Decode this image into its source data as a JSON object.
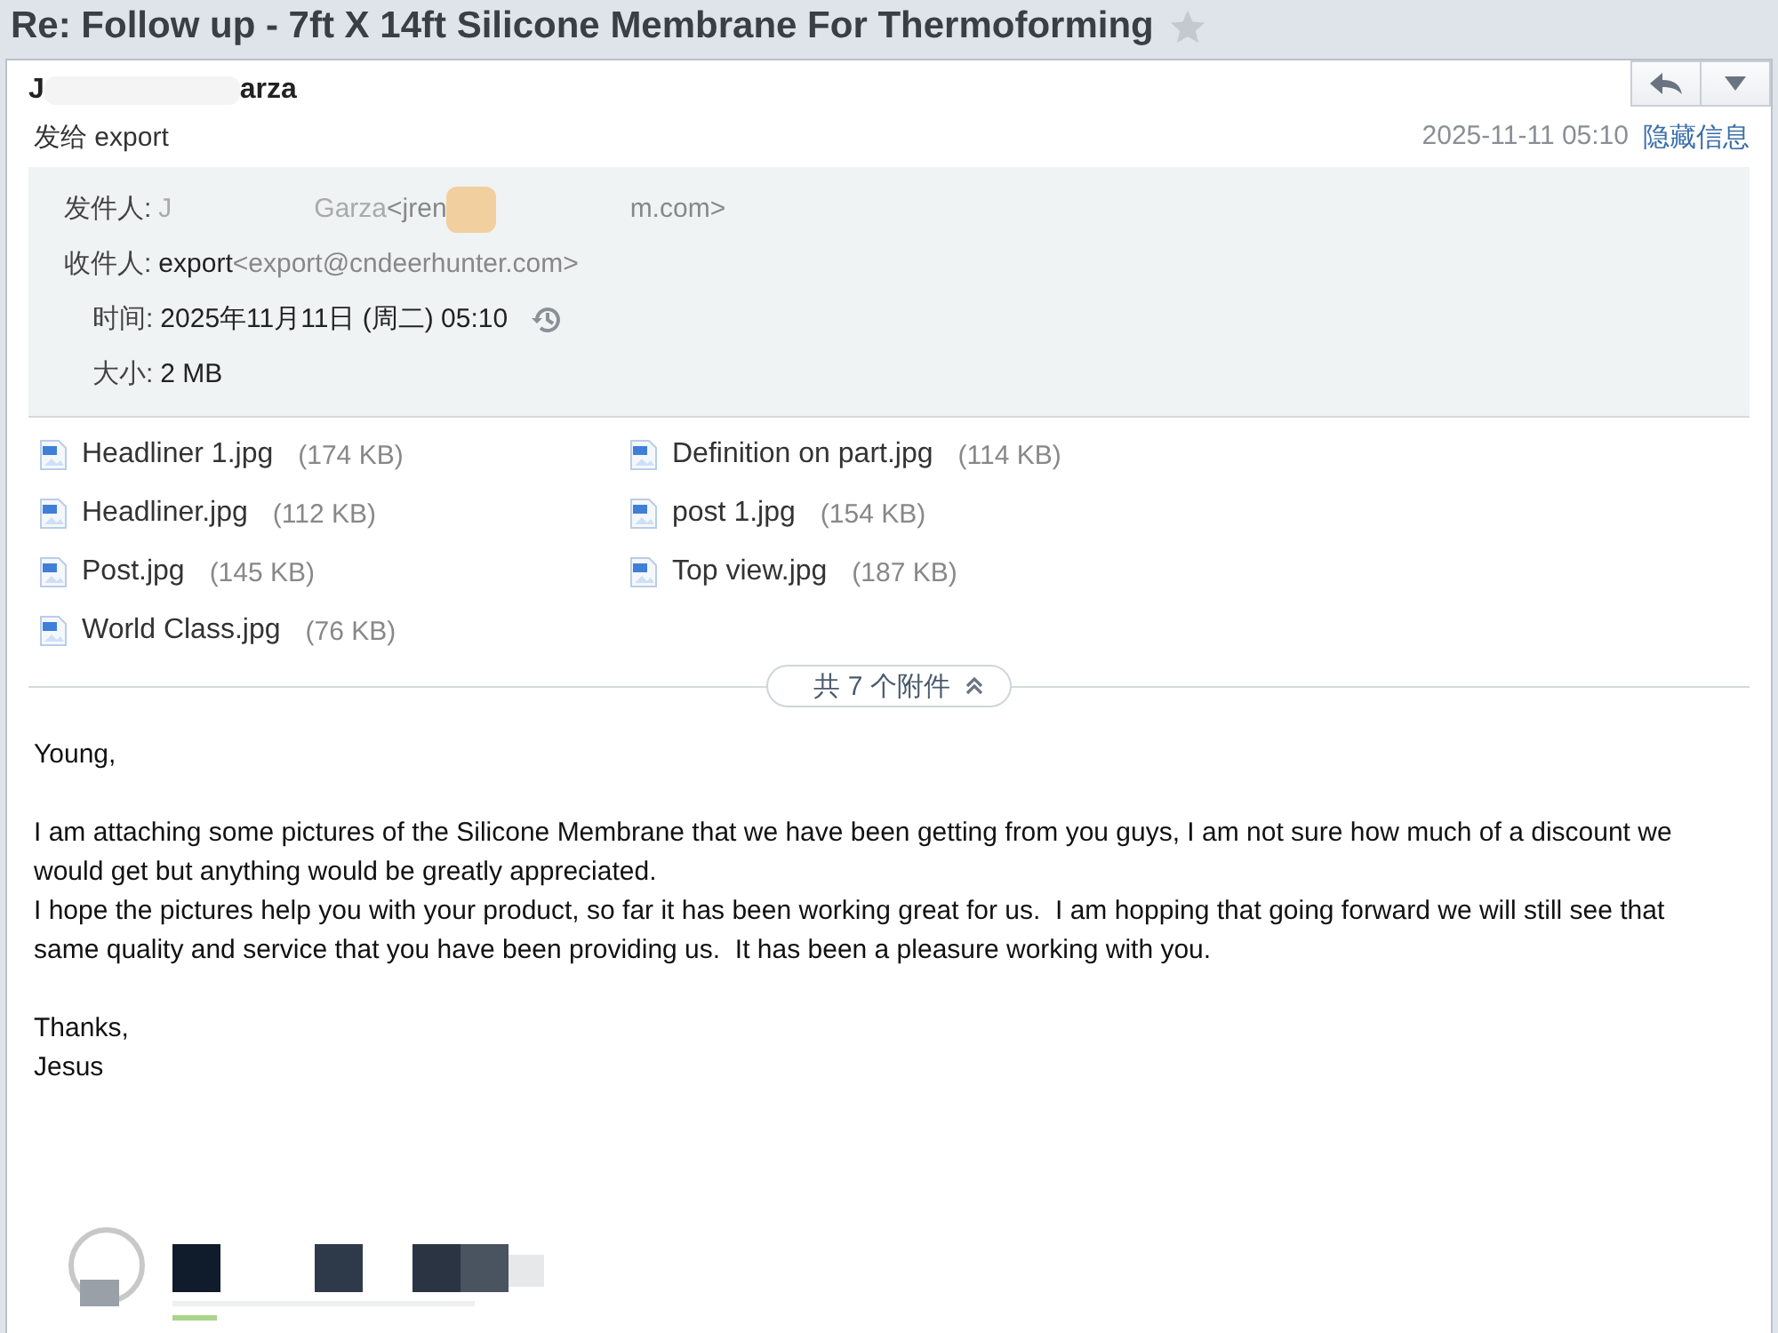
{
  "subject": "Re: Follow up - 7ft X 14ft Silicone Membrane For Thermoforming",
  "starred": false,
  "sender": {
    "name_start": "J",
    "name_end": "arza"
  },
  "to_line": "发给 export",
  "date": "2025-11-11 05:10",
  "hide_details_link": "隐藏信息",
  "details": {
    "from": {
      "label": "发件人:",
      "name_start": "J",
      "name_end": "Garza",
      "email_start": "<jren",
      "email_end": "m.com>"
    },
    "to": {
      "label": "收件人:",
      "name": "export",
      "email": "<export@cndeerhunter.com>"
    },
    "time": {
      "label": "时间:",
      "value": "2025年11月11日 (周二) 05:10"
    },
    "size": {
      "label": "大小:",
      "value": "2 MB"
    }
  },
  "attachments": [
    {
      "name": "Headliner 1.jpg",
      "size": "(174 KB)"
    },
    {
      "name": "Definition on part.jpg",
      "size": "(114 KB)"
    },
    {
      "name": "Headliner.jpg",
      "size": "(112 KB)"
    },
    {
      "name": "post 1.jpg",
      "size": "(154 KB)"
    },
    {
      "name": "Post.jpg",
      "size": "(145 KB)"
    },
    {
      "name": "Top view.jpg",
      "size": "(187 KB)"
    },
    {
      "name": "World Class.jpg",
      "size": "(76 KB)"
    }
  ],
  "attachments_toggle": {
    "label": "共 7 个附件",
    "expanded": true
  },
  "body": [
    {
      "lines": [
        "Young,"
      ]
    },
    {
      "lines": [
        "I am attaching some pictures of the Silicone Membrane that we have been getting from you guys, I am not sure how much of a discount we would get but anything would be greatly appreciated.",
        "I hope the pictures help you with your product, so far it has been working great for us.  I am hopping that going forward we will still see that same quality and service that you have been providing us.  It has been a pleasure working with you."
      ]
    },
    {
      "lines": [
        "Thanks,",
        "Jesus"
      ]
    }
  ]
}
